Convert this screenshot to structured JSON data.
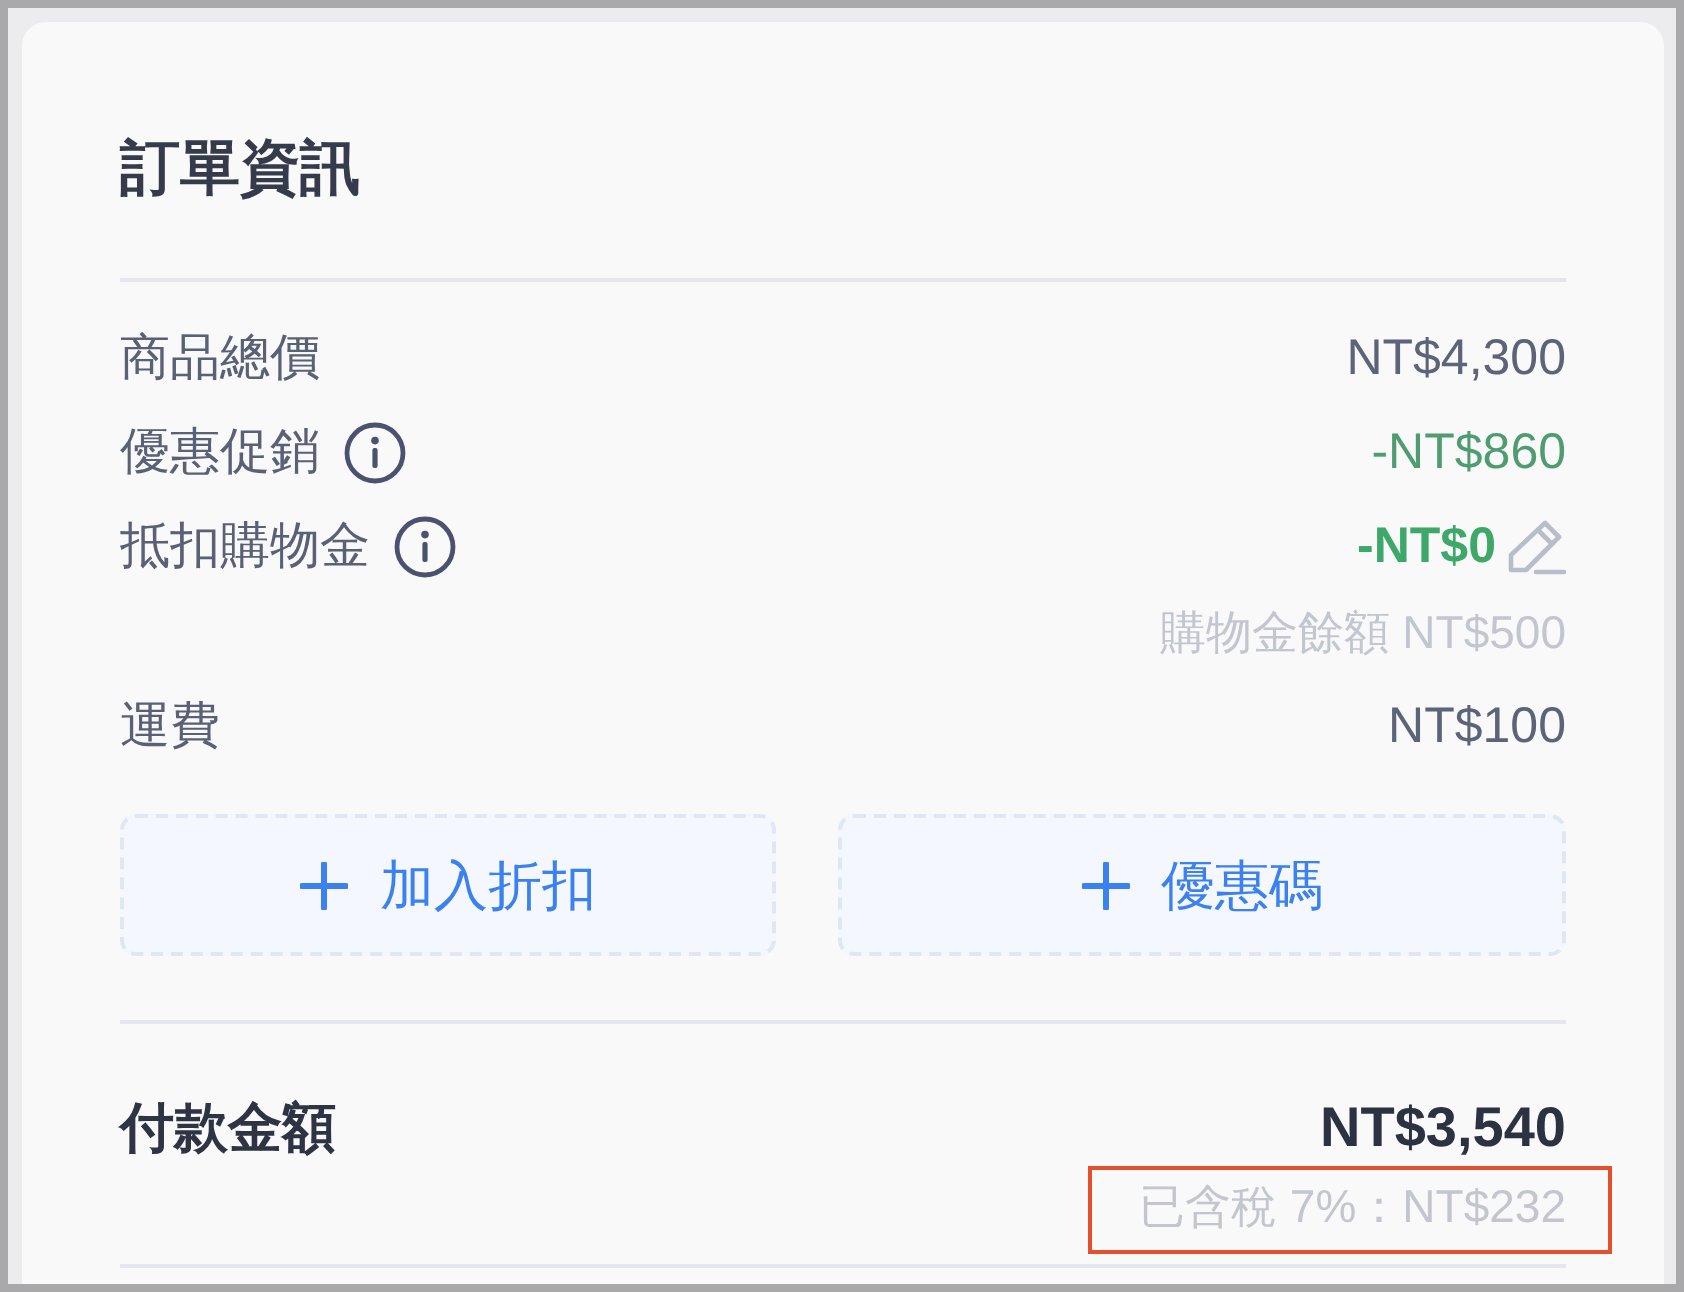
{
  "card": {
    "title": "訂單資訊"
  },
  "line_items": [
    {
      "label": "商品總價",
      "value": "NT$4,300",
      "kind": "plain",
      "info": false,
      "editable": false
    },
    {
      "label": "優惠促銷",
      "value": "-NT$860",
      "kind": "discount",
      "info": true,
      "editable": false
    },
    {
      "label": "抵扣購物金",
      "value": "-NT$0",
      "kind": "credit",
      "info": true,
      "editable": true,
      "note": "購物金餘額 NT$500"
    },
    {
      "label": "運費",
      "value": "NT$100",
      "kind": "plain",
      "info": false,
      "editable": false
    }
  ],
  "actions": [
    {
      "label": "加入折扣"
    },
    {
      "label": "優惠碼"
    }
  ],
  "total": {
    "label": "付款金額",
    "value": "NT$3,540",
    "tax_note": "已含稅 7%：NT$232",
    "highlighted": true
  }
}
